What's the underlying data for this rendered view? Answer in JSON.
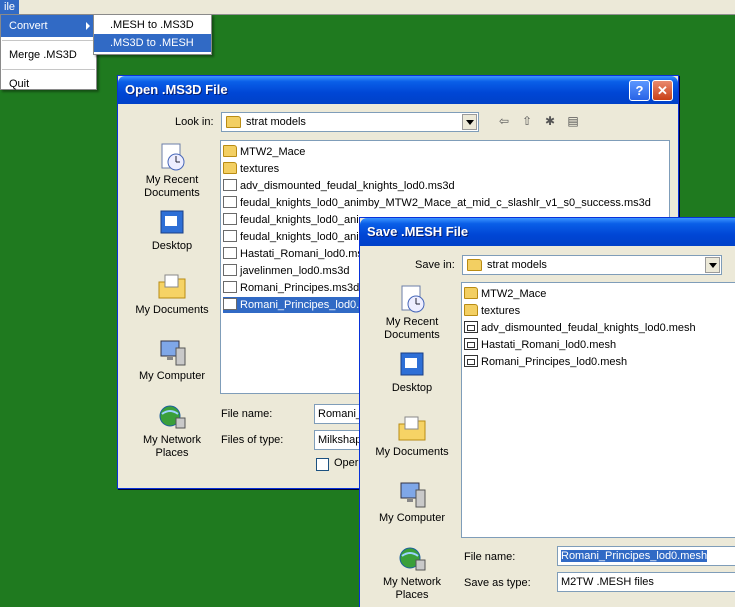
{
  "menubar": {
    "file_label": "ile"
  },
  "menu": {
    "items": [
      {
        "label": "Convert"
      },
      {
        "label": "Merge .MS3D"
      },
      {
        "label": "Quit"
      }
    ],
    "submenu": [
      {
        "label": ".MESH to .MS3D"
      },
      {
        "label": ".MS3D to .MESH"
      }
    ]
  },
  "open_dialog": {
    "title": "Open .MS3D File",
    "help_btn": "?",
    "close_btn": "✕",
    "look_in_label": "Look in:",
    "look_in_value": "strat models",
    "places": [
      "My Recent Documents",
      "Desktop",
      "My Documents",
      "My Computer",
      "My Network Places"
    ],
    "files": [
      {
        "name": "MTW2_Mace",
        "type": "folder"
      },
      {
        "name": "textures",
        "type": "folder"
      },
      {
        "name": "adv_dismounted_feudal_knights_lod0.ms3d",
        "type": "file"
      },
      {
        "name": "feudal_knights_lod0_animby_MTW2_Mace_at_mid_c_slashlr_v1_s0_success.ms3d",
        "type": "file"
      },
      {
        "name": "feudal_knights_lod0_ani",
        "type": "file"
      },
      {
        "name": "feudal_knights_lod0_ani",
        "type": "file"
      },
      {
        "name": "Hastati_Romani_lod0.ms",
        "type": "file"
      },
      {
        "name": "javelinmen_lod0.ms3d",
        "type": "file"
      },
      {
        "name": "Romani_Principes.ms3d",
        "type": "file"
      },
      {
        "name": "Romani_Principes_lod0.ms",
        "type": "file"
      }
    ],
    "file_name_label": "File name:",
    "file_name_value": "Romani_",
    "files_of_type_label": "Files of type:",
    "files_of_type_value": "Milkshap",
    "open_readonly_label": "Oper"
  },
  "save_dialog": {
    "title": "Save .MESH File",
    "save_in_label": "Save in:",
    "save_in_value": "strat models",
    "places": [
      "My Recent Documents",
      "Desktop",
      "My Documents",
      "My Computer",
      "My Network Places"
    ],
    "files": [
      {
        "name": "MTW2_Mace",
        "type": "folder"
      },
      {
        "name": "textures",
        "type": "folder"
      },
      {
        "name": "adv_dismounted_feudal_knights_lod0.mesh",
        "type": "mesh"
      },
      {
        "name": "Hastati_Romani_lod0.mesh",
        "type": "mesh"
      },
      {
        "name": "Romani_Principes_lod0.mesh",
        "type": "mesh"
      }
    ],
    "file_name_label": "File name:",
    "file_name_value": "Romani_Principes_lod0.mesh",
    "save_as_type_label": "Save as type:",
    "save_as_type_value": "M2TW .MESH files"
  },
  "colors": {
    "desktop": "#1f7a1f",
    "highlight": "#316ac5",
    "titlebar": "#0046d5",
    "dialog_bg": "#ece9d8"
  }
}
